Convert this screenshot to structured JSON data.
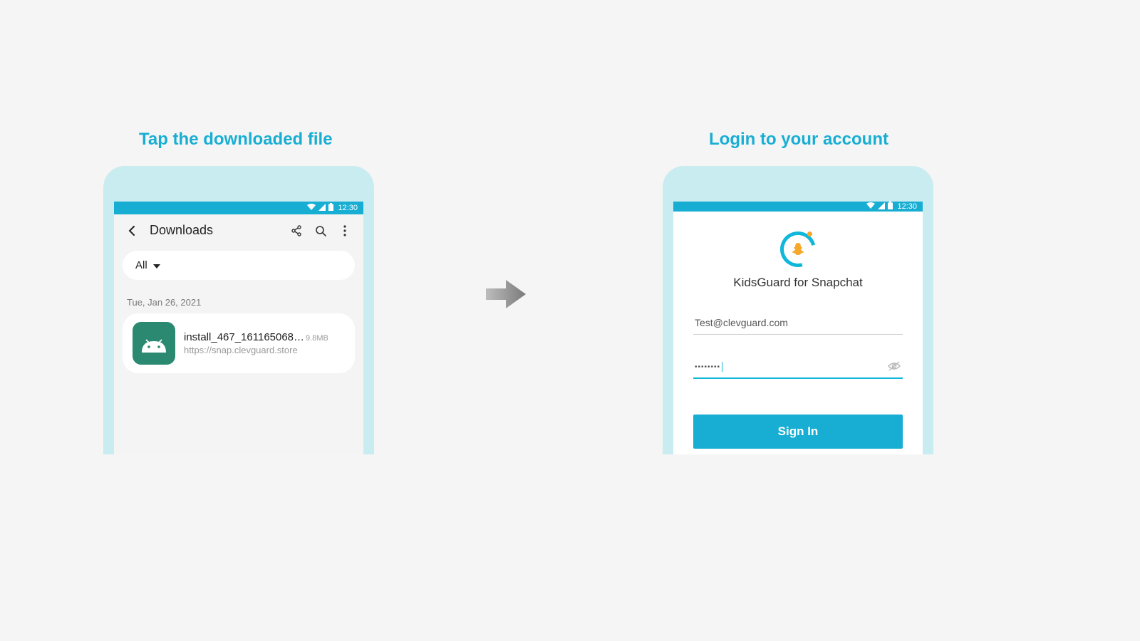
{
  "left": {
    "caption": "Tap the downloaded file",
    "status_time": "12:30",
    "title": "Downloads",
    "filter": "All",
    "date": "Tue, Jan 26, 2021",
    "file": {
      "name": "install_467_161165068…",
      "size": "9.8MB",
      "url": "https://snap.clevguard.store"
    }
  },
  "right": {
    "caption": "Login to your account",
    "status_time": "12:30",
    "app_title": "KidsGuard for Snapchat",
    "email_value": "Test@clevguard.com",
    "password_mask": "••••••••",
    "signin_label": "Sign In"
  },
  "colors": {
    "accent": "#18aed3",
    "shell": "#c9ecf0",
    "orange": "#f6a82b"
  }
}
